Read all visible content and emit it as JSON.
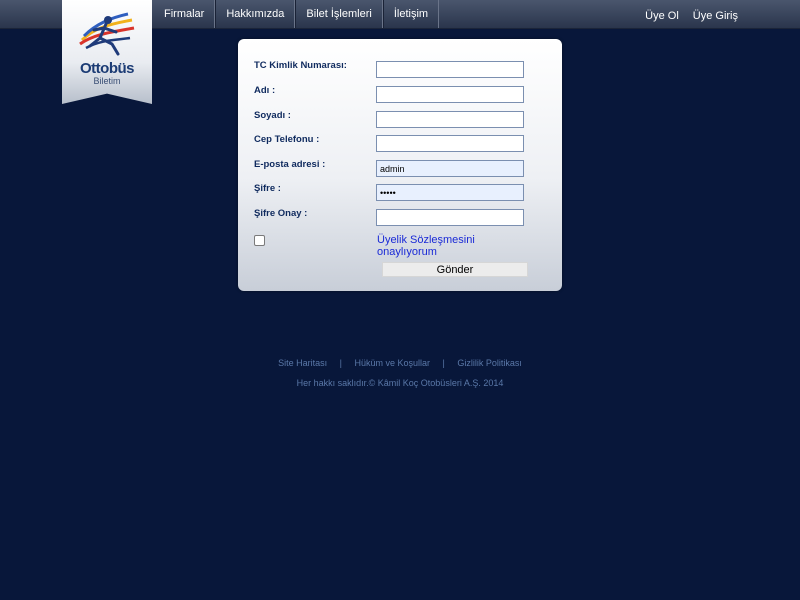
{
  "brand": {
    "name": "Ottobüs",
    "subtitle": "Biletim"
  },
  "nav": {
    "items": [
      {
        "label": "Firmalar"
      },
      {
        "label": "Hakkımızda"
      },
      {
        "label": "Bilet İşlemleri"
      },
      {
        "label": "İletişim"
      }
    ]
  },
  "user_links": {
    "register": "Üye Ol",
    "login": "Üye Giriş"
  },
  "form": {
    "fields": [
      {
        "label": "TC Kimlik Numarası:",
        "value": ""
      },
      {
        "label": "Adı :",
        "value": ""
      },
      {
        "label": "Soyadı :",
        "value": ""
      },
      {
        "label": "Cep Telefonu :",
        "value": ""
      },
      {
        "label": "E-posta adresi :",
        "value": "admin"
      },
      {
        "label": "Şifre :",
        "value": "•••••"
      },
      {
        "label": "Şifre Onay :",
        "value": ""
      }
    ],
    "agreement_checked": false,
    "agreement_label": "Üyelik Sözleşmesini onaylıyorum",
    "submit_label": "Gönder"
  },
  "footer": {
    "links": [
      "Site Haritası",
      "Hüküm ve Koşullar",
      "Gizlilik Politikası"
    ],
    "separator": "|",
    "copyright": "Her hakkı saklıdır.© Kâmil Koç Otobüsleri A.Ş. 2014"
  },
  "colors": {
    "background": "#08173a",
    "label": "#0f2a5e",
    "link": "#1a2ad6",
    "footer_text": "#5a78a8"
  },
  "icons": {
    "logo": "runner-logo-icon"
  }
}
